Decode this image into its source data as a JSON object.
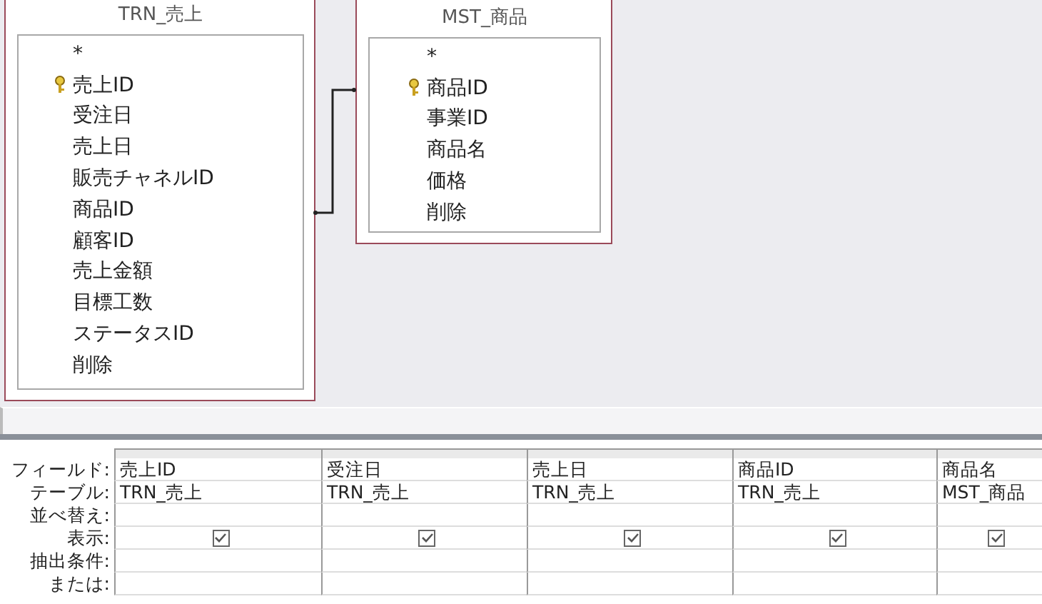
{
  "tables": [
    {
      "title": "TRN_売上",
      "fields": [
        {
          "name": "*",
          "key": false
        },
        {
          "name": "売上ID",
          "key": true
        },
        {
          "name": "受注日",
          "key": false
        },
        {
          "name": "売上日",
          "key": false
        },
        {
          "name": "販売チャネルID",
          "key": false
        },
        {
          "name": "商品ID",
          "key": false
        },
        {
          "name": "顧客ID",
          "key": false
        },
        {
          "name": "売上金額",
          "key": false
        },
        {
          "name": "目標工数",
          "key": false
        },
        {
          "name": "ステータスID",
          "key": false
        },
        {
          "name": "削除",
          "key": false
        }
      ]
    },
    {
      "title": "MST_商品",
      "fields": [
        {
          "name": "*",
          "key": false
        },
        {
          "name": "商品ID",
          "key": true
        },
        {
          "name": "事業ID",
          "key": false
        },
        {
          "name": "商品名",
          "key": false
        },
        {
          "name": "価格",
          "key": false
        },
        {
          "name": "削除",
          "key": false
        }
      ]
    }
  ],
  "grid": {
    "row_labels": [
      "フィールド:",
      "テーブル:",
      "並べ替え:",
      "表示:",
      "抽出条件:",
      "または:"
    ],
    "columns": [
      {
        "field": "売上ID",
        "table": "TRN_売上",
        "show": true
      },
      {
        "field": "受注日",
        "table": "TRN_売上",
        "show": true
      },
      {
        "field": "売上日",
        "table": "TRN_売上",
        "show": true
      },
      {
        "field": "商品ID",
        "table": "TRN_売上",
        "show": true
      },
      {
        "field": "商品名",
        "table": "MST_商品",
        "show": true
      }
    ]
  }
}
